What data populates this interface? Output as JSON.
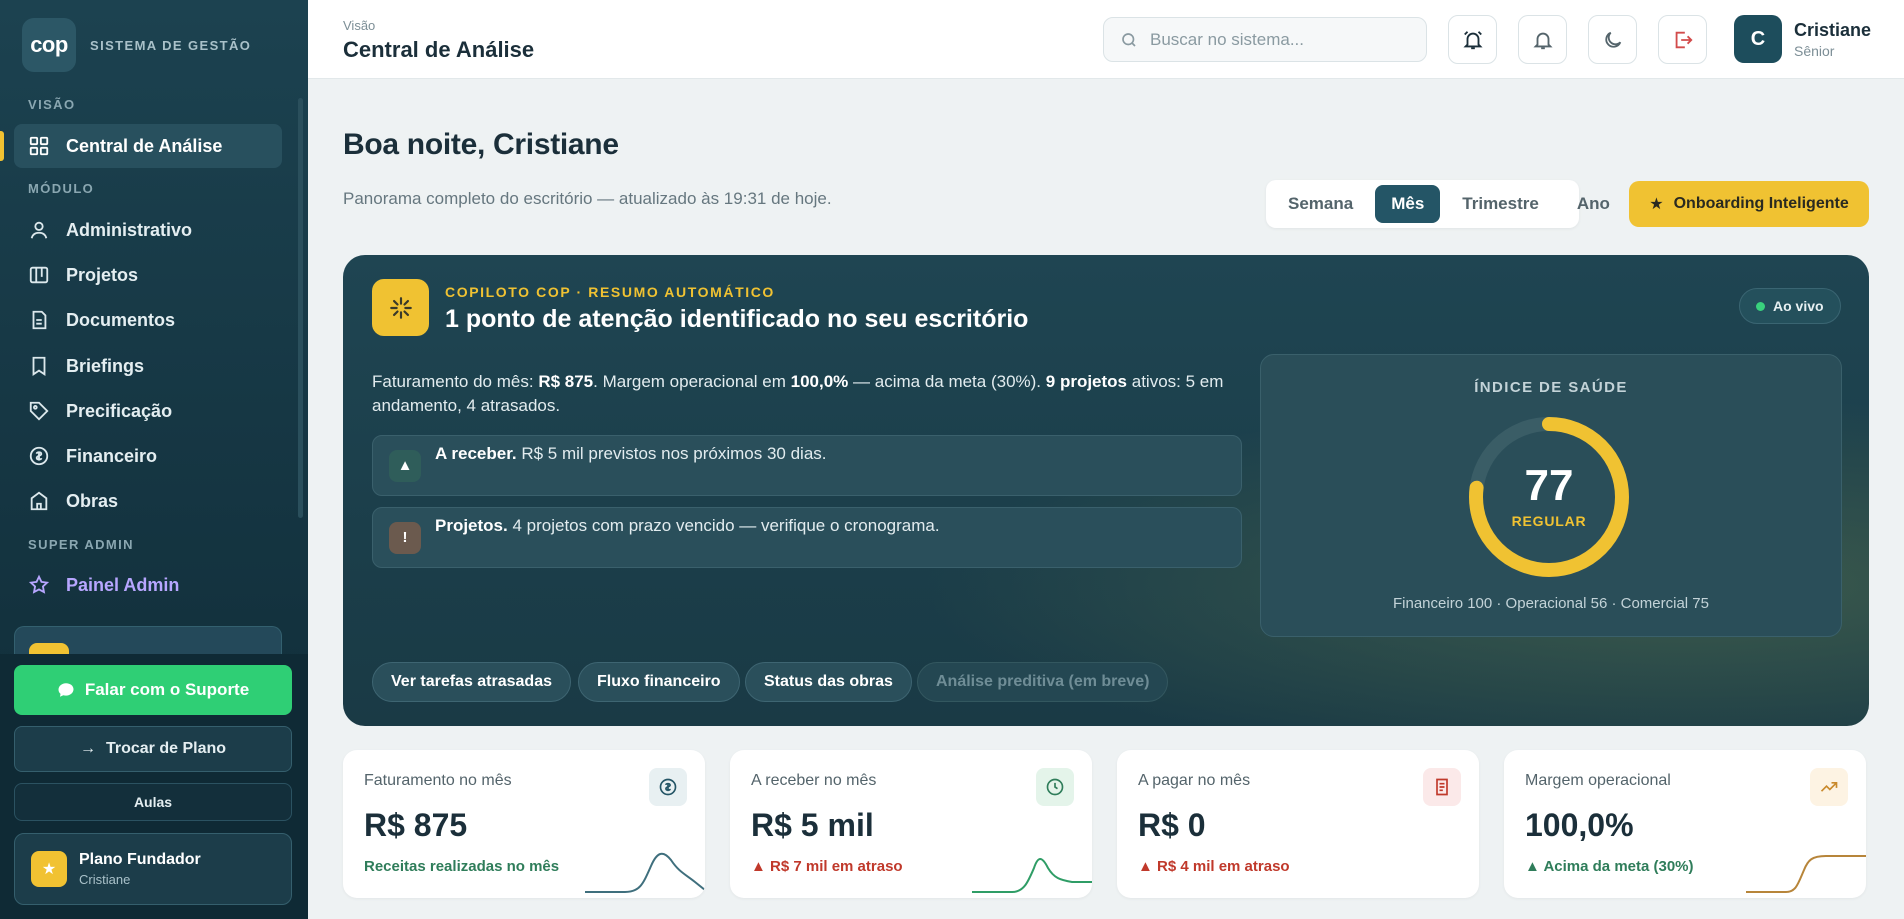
{
  "sidebar": {
    "brand_logo": "cop",
    "brand_text": "SISTEMA DE GESTÃO",
    "sections": {
      "visao": "VISÃO",
      "modulo": "MÓDULO",
      "super_admin": "SUPER ADMIN"
    },
    "items": {
      "central": "Central de Análise",
      "administrativo": "Administrativo",
      "projetos": "Projetos",
      "documentos": "Documentos",
      "briefings": "Briefings",
      "precificacao": "Precificação",
      "financeiro": "Financeiro",
      "obras": "Obras",
      "painel_admin": "Painel Admin"
    },
    "support_button": "Falar com o Suporte",
    "plan_button": "Trocar de Plano",
    "aulas_button": "Aulas",
    "plan_card": {
      "name": "Plano Fundador",
      "user": "Cristiane"
    }
  },
  "header": {
    "breadcrumb": "Visão",
    "title": "Central de Análise",
    "search_placeholder": "Buscar no sistema...",
    "user": {
      "initial": "C",
      "name": "Cristiane",
      "role": "Sênior"
    }
  },
  "main": {
    "greeting": "Boa noite, Cristiane",
    "subline": "Panorama completo do escritório — atualizado às 19:31 de hoje.",
    "period_options": [
      "Semana",
      "Mês",
      "Trimestre",
      "Ano"
    ],
    "period_selected": "Mês",
    "onboarding_button": "Onboarding Inteligente"
  },
  "copilot": {
    "kicker": "COPILOTO COP · RESUMO AUTOMÁTICO",
    "title": "1 ponto de atenção identificado no seu escritório",
    "live_badge": "Ao vivo",
    "summary": {
      "t1": "Faturamento do mês: ",
      "revenue": "R$ 875",
      "t2": ". Margem operacional em ",
      "margin": "100,0%",
      "t3": " — acima da meta (30%). ",
      "projects": "9 projetos",
      "t4": " ativos: 5 em andamento, 4 atrasados."
    },
    "alerts": [
      {
        "title": "A receber.",
        "text": " R$ 5 mil previstos nos próximos 30 dias."
      },
      {
        "title": "Projetos.",
        "text": " 4 projetos com prazo vencido — verifique o cronograma."
      }
    ],
    "health": {
      "title": "ÍNDICE DE SAÚDE",
      "score": 77,
      "max": 100,
      "label": "REGULAR",
      "breakdown": "Financeiro 100 · Operacional 56 · Comercial 75"
    },
    "chips": [
      "Ver tarefas atrasadas",
      "Fluxo financeiro",
      "Status das obras",
      "Análise preditiva (em breve)"
    ]
  },
  "kpis": [
    {
      "label": "Faturamento no mês",
      "value": "R$ 875",
      "foot": "Receitas realizadas no mês",
      "foot_color": "#2f7d5a"
    },
    {
      "label": "A receber no mês",
      "value": "R$ 5 mil",
      "foot": "▲ R$ 7 mil em atraso",
      "foot_color": "#c0392b"
    },
    {
      "label": "A pagar no mês",
      "value": "R$ 0",
      "foot": "▲ R$ 4 mil em atraso",
      "foot_color": "#c0392b"
    },
    {
      "label": "Margem operacional",
      "value": "100,0%",
      "foot": "▲ Acima da meta (30%)",
      "foot_color": "#2f7d5a"
    }
  ],
  "colors": {
    "accent": "#f0c232",
    "primary": "#1d4d5c",
    "success": "#2fcf75",
    "danger": "#c0392b"
  }
}
